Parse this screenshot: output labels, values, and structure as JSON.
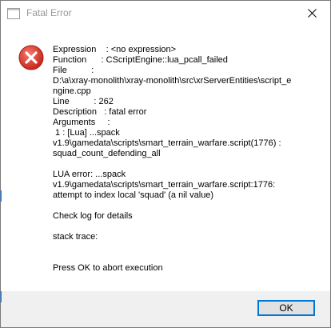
{
  "window": {
    "title": "Fatal Error"
  },
  "message": {
    "lines": [
      "Expression    : <no expression>",
      "Function      : CScriptEngine::lua_pcall_failed",
      "File          :",
      "D:\\a\\xray-monolith\\xray-monolith\\src\\xrServerEntities\\script_e",
      "ngine.cpp",
      "Line          : 262",
      "Description   : fatal error",
      "Arguments     :",
      " 1 : [Lua] ...spack",
      "v1.9\\gamedata\\scripts\\smart_terrain_warfare.script(1776) :",
      "squad_count_defending_all",
      "",
      "LUA error: ...spack",
      "v1.9\\gamedata\\scripts\\smart_terrain_warfare.script:1776:",
      "attempt to index local 'squad' (a nil value)",
      "",
      "Check log for details",
      "",
      "stack trace:",
      "",
      "",
      "Press OK to abort execution"
    ]
  },
  "buttons": {
    "ok_label": "OK"
  },
  "icons": {
    "title": "app-icon",
    "error": "error-icon",
    "close": "close-icon"
  },
  "colors": {
    "error_red": "#e03c31",
    "accent": "#0078d7"
  }
}
